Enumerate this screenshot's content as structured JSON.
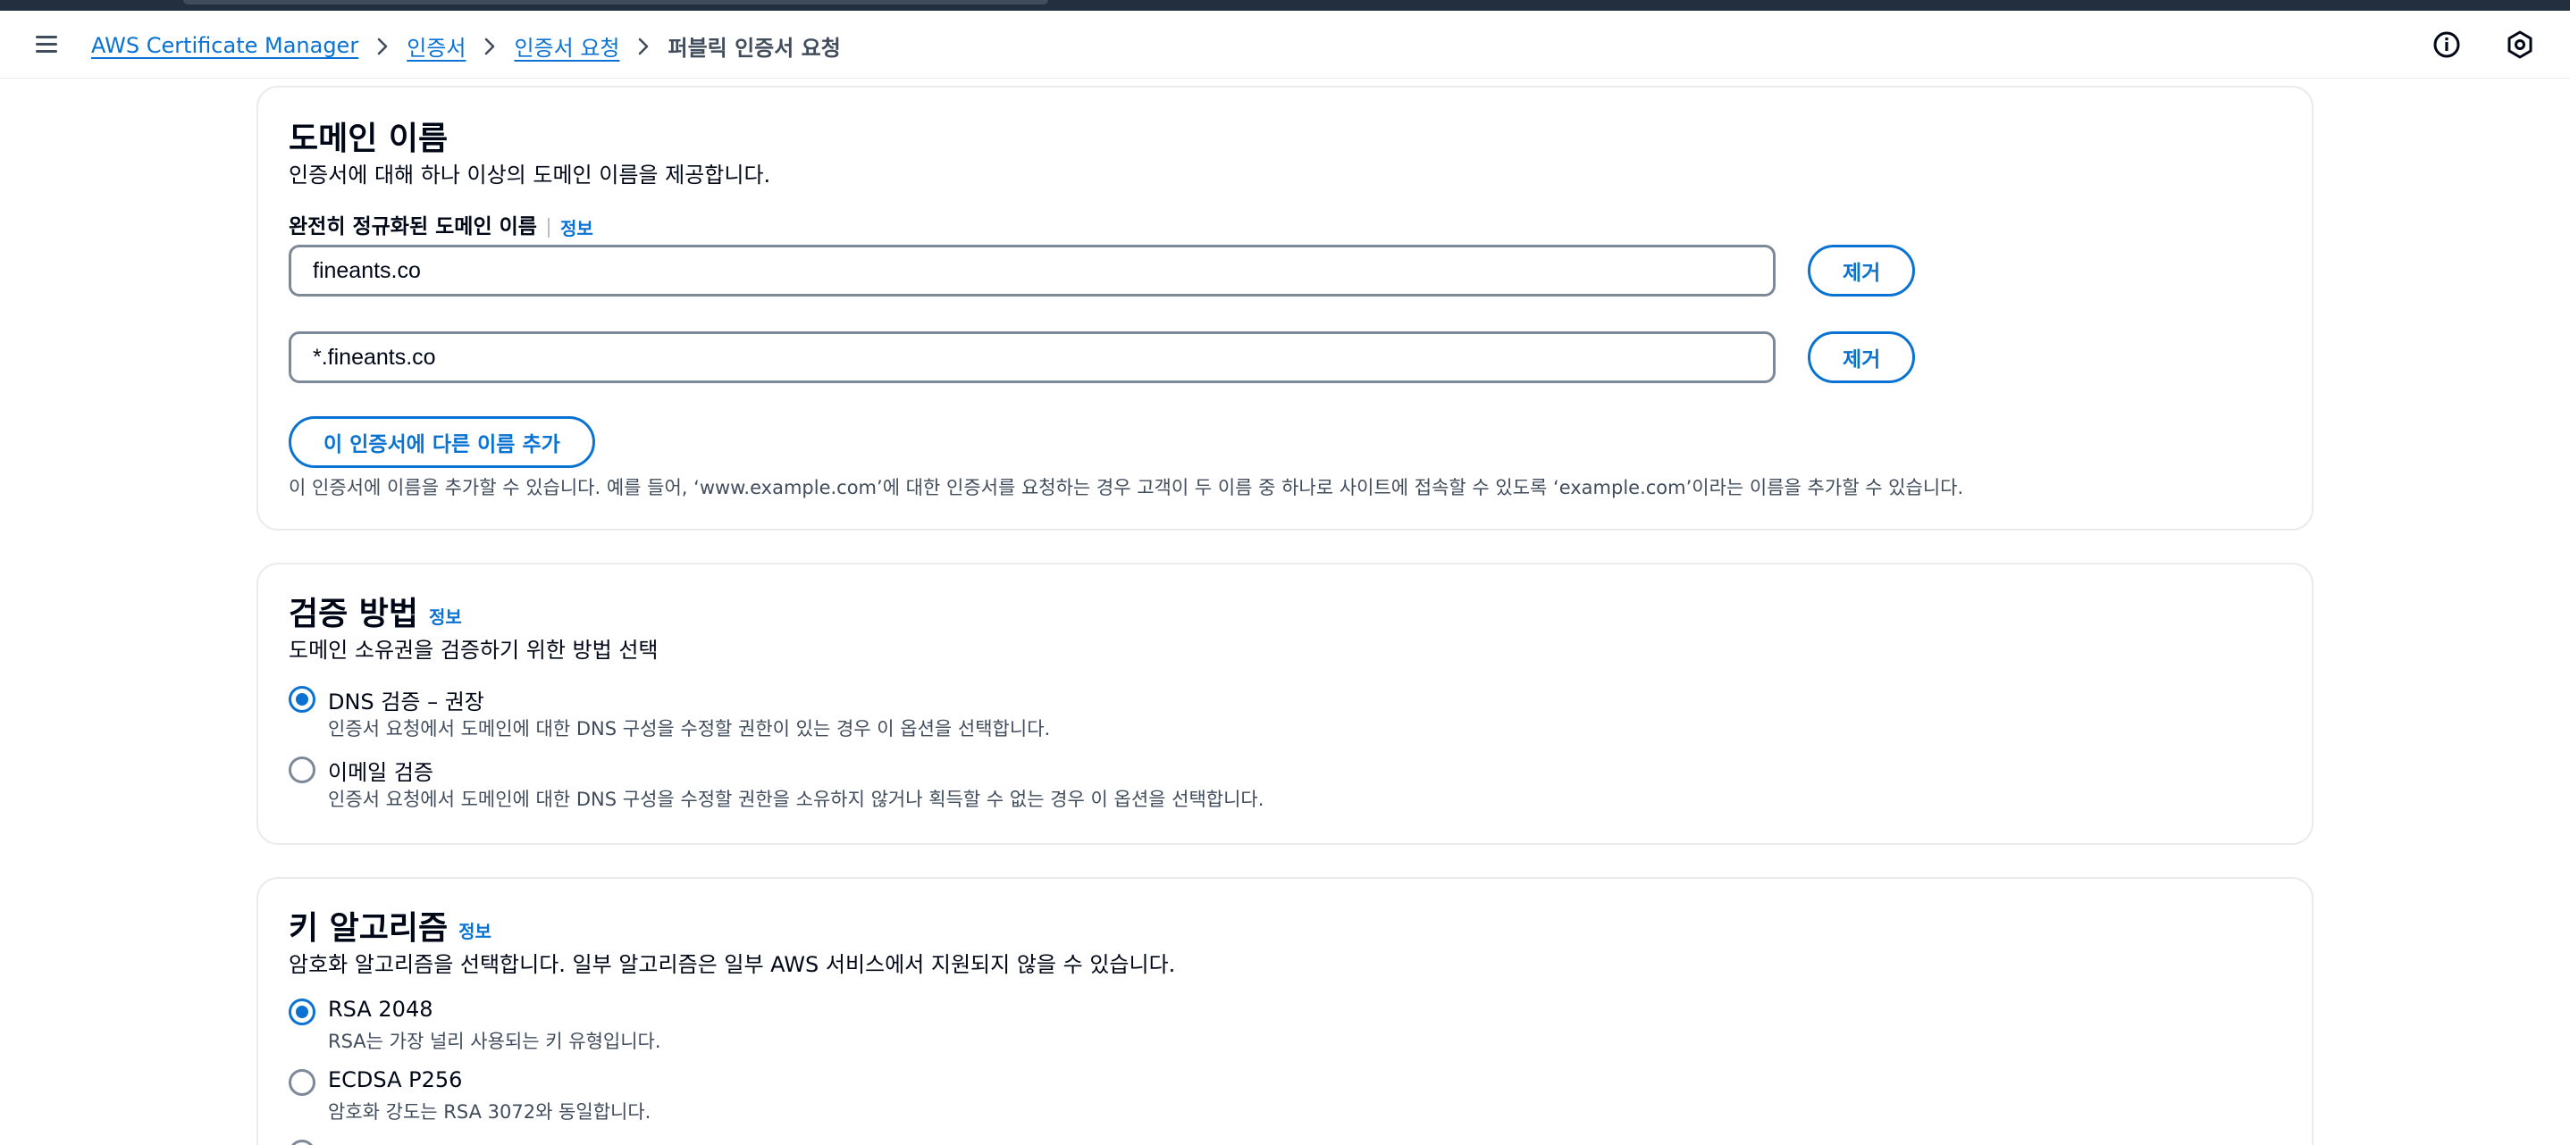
{
  "breadcrumb": {
    "items": [
      "AWS Certificate Manager",
      "인증서",
      "인증서 요청"
    ],
    "current": "퍼블릭 인증서 요청"
  },
  "domain_names": {
    "title": "도메인 이름",
    "description": "인증서에 대해 하나 이상의 도메인 이름을 제공합니다.",
    "field_label": "완전히 정규화된 도메인 이름",
    "info": "정보",
    "entries": [
      {
        "value": "fineants.co",
        "remove_label": "제거"
      },
      {
        "value": "*.fineants.co",
        "remove_label": "제거"
      }
    ],
    "add_button": "이 인증서에 다른 이름 추가",
    "helper": "이 인증서에 이름을 추가할 수 있습니다. 예를 들어, ‘www.example.com’에 대한 인증서를 요청하는 경우 고객이 두 이름 중 하나로 사이트에 접속할 수 있도록 ‘example.com’이라는 이름을 추가할 수 있습니다."
  },
  "validation": {
    "title": "검증 방법",
    "info": "정보",
    "description": "도메인 소유권을 검증하기 위한 방법 선택",
    "options": [
      {
        "label": "DNS 검증 – 권장",
        "description": "인증서 요청에서 도메인에 대한 DNS 구성을 수정할 권한이 있는 경우 이 옵션을 선택합니다.",
        "checked": true
      },
      {
        "label": "이메일 검증",
        "description": "인증서 요청에서 도메인에 대한 DNS 구성을 수정할 권한을 소유하지 않거나 획득할 수 없는 경우 이 옵션을 선택합니다.",
        "checked": false
      }
    ]
  },
  "key_algorithm": {
    "title": "키 알고리즘",
    "info": "정보",
    "description": "암호화 알고리즘을 선택합니다. 일부 알고리즘은 일부 AWS 서비스에서 지원되지 않을 수 있습니다.",
    "options": [
      {
        "label": "RSA 2048",
        "description": "RSA는 가장 널리 사용되는 키 유형입니다.",
        "checked": true
      },
      {
        "label": "ECDSA P256",
        "description": "암호화 강도는 RSA 3072와 동일합니다.",
        "checked": false
      }
    ]
  },
  "colors": {
    "accent": "#0972d3",
    "text": "#000716",
    "secondary_text": "#414d5c",
    "border": "#e9ebed"
  }
}
